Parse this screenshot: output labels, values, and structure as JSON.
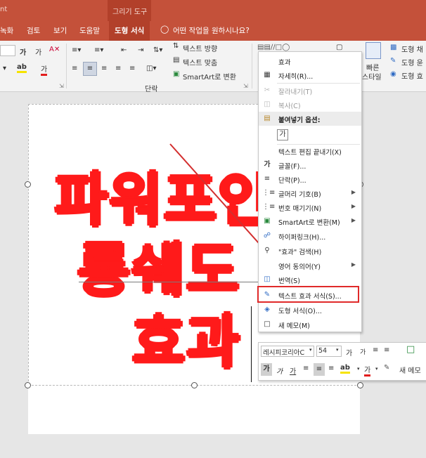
{
  "titlebar": {
    "app_title": "nt",
    "context_group": "그리기 도구"
  },
  "tabs": [
    {
      "label": "녹화"
    },
    {
      "label": "검토"
    },
    {
      "label": "보기"
    },
    {
      "label": "도움말"
    },
    {
      "label": "도형 서식"
    }
  ],
  "tellme": {
    "text": "어떤 작업을 원하시나요?"
  },
  "ribbon": {
    "font_bold": "가",
    "font_italic": "가",
    "text_direction": "텍스트 방향",
    "align_text": "텍스트 맞춤",
    "smartart": "SmartArt로 변환",
    "paragraph_group": "단락",
    "quick_style": "빠른",
    "quick_style2": "스타일",
    "shape_fill": "도형 채",
    "shape_outline": "도형 윤",
    "shape_effect": "도형 효"
  },
  "slide": {
    "line1": "파워포인",
    "line2": "롱쉐도",
    "line3": "효과"
  },
  "context_menu": {
    "items": [
      {
        "label": "효과",
        "icon": "text-icon",
        "disabled": false
      },
      {
        "label": "자세히(R)...",
        "icon": "smart-lookup-icon",
        "disabled": false
      },
      {
        "label": "잘라내기(T)",
        "icon": "scissors-icon",
        "disabled": true
      },
      {
        "label": "복사(C)",
        "icon": "copy-icon",
        "disabled": true
      },
      {
        "label": "붙여넣기 옵션:",
        "icon": "paste-icon",
        "disabled": false
      },
      {
        "label": "가",
        "icon": "paste-text-icon",
        "disabled": false
      },
      {
        "label": "텍스트 편집 끝내기(X)",
        "icon": "",
        "disabled": false
      },
      {
        "label": "글꼴(F)...",
        "icon": "font-icon",
        "disabled": false
      },
      {
        "label": "단락(P)...",
        "icon": "paragraph-icon",
        "disabled": false
      },
      {
        "label": "글머리 기호(B)",
        "icon": "bullets-icon",
        "disabled": false,
        "submenu": true
      },
      {
        "label": "번호 매기기(N)",
        "icon": "numbering-icon",
        "disabled": false,
        "submenu": true
      },
      {
        "label": "SmartArt로 변환(M)",
        "icon": "smartart-icon",
        "disabled": false,
        "submenu": true
      },
      {
        "label": "하이퍼링크(H)...",
        "icon": "hyperlink-icon",
        "disabled": false
      },
      {
        "label": "\"효과\" 검색(H)",
        "icon": "search-icon",
        "disabled": false
      },
      {
        "label": "영어 동의어(Y)",
        "icon": "",
        "disabled": false,
        "submenu": true
      },
      {
        "label": "번역(S)",
        "icon": "translate-icon",
        "disabled": false
      },
      {
        "label": "텍스트 효과 서식(S)...",
        "icon": "text-effects-icon",
        "disabled": false
      },
      {
        "label": "도형 서식(O)...",
        "icon": "shape-format-icon",
        "disabled": false
      },
      {
        "label": "새 메모(M)",
        "icon": "new-comment-icon",
        "disabled": false
      }
    ]
  },
  "mini_toolbar": {
    "font_name": "레시피코리아C",
    "font_size": "54",
    "grow": "가",
    "shrink": "가",
    "bold": "가",
    "italic": "가",
    "underline": "가",
    "font_color": "가",
    "new_comment": "새 메모"
  },
  "colors": {
    "accent": "#c4513a",
    "highlight_box": "#e02a2a",
    "slide_text": "#ff1a1a",
    "arrow": "#d32f2f"
  }
}
